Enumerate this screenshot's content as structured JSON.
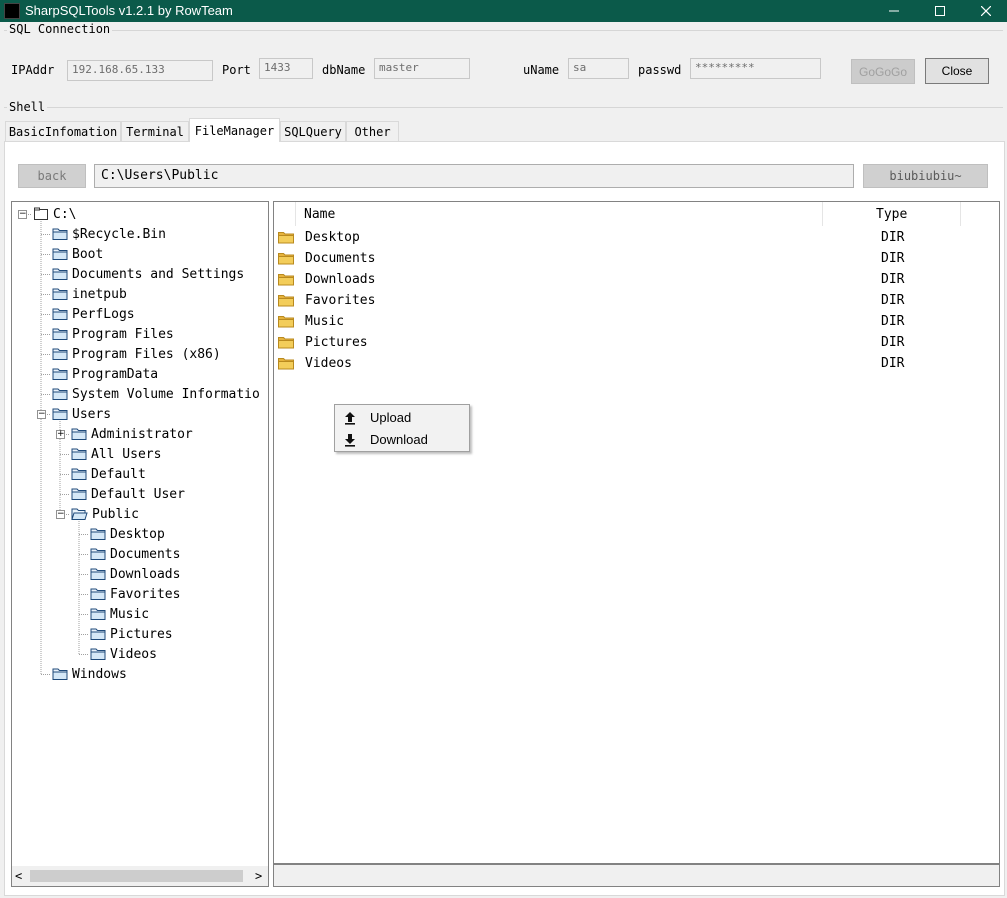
{
  "window": {
    "title": "SharpSQLTools v1.2.1 by RowTeam",
    "controls": {
      "minimize": "—",
      "maximize": "☐",
      "close": "✕"
    }
  },
  "connection": {
    "group_label": "SQL Connection",
    "ip_label": "IPAddr",
    "ip_value": "192.168.65.133",
    "port_label": "Port",
    "port_value": "1433",
    "db_label": "dbName",
    "db_value": "master",
    "user_label": "uName",
    "user_value": "sa",
    "pass_label": "passwd",
    "pass_value": "*********",
    "go_button": "GoGoGo",
    "close_button": "Close"
  },
  "shell": {
    "group_label": "Shell",
    "tabs": [
      {
        "label": "BasicInfomation",
        "active": false
      },
      {
        "label": "Terminal",
        "active": false
      },
      {
        "label": "FileManager",
        "active": true
      },
      {
        "label": "SQLQuery",
        "active": false
      },
      {
        "label": "Other",
        "active": false
      }
    ]
  },
  "file_manager": {
    "back_button": "back",
    "path": "C:\\Users\\Public",
    "action_button": "biubiubiu~",
    "tree": [
      {
        "label": "C:\\",
        "level": 0,
        "expander": "minus",
        "icon": "drive-icon"
      },
      {
        "label": "$Recycle.Bin",
        "level": 1
      },
      {
        "label": "Boot",
        "level": 1
      },
      {
        "label": "Documents and Settings",
        "level": 1
      },
      {
        "label": "inetpub",
        "level": 1
      },
      {
        "label": "PerfLogs",
        "level": 1
      },
      {
        "label": "Program Files",
        "level": 1
      },
      {
        "label": "Program Files (x86)",
        "level": 1
      },
      {
        "label": "ProgramData",
        "level": 1
      },
      {
        "label": "System Volume Informatio",
        "level": 1
      },
      {
        "label": "Users",
        "level": 1,
        "expander": "minus"
      },
      {
        "label": "Administrator",
        "level": 2,
        "expander": "plus"
      },
      {
        "label": "All Users",
        "level": 2
      },
      {
        "label": "Default",
        "level": 2
      },
      {
        "label": "Default User",
        "level": 2
      },
      {
        "label": "Public",
        "level": 2,
        "expander": "minus",
        "open": true
      },
      {
        "label": "Desktop",
        "level": 3
      },
      {
        "label": "Documents",
        "level": 3
      },
      {
        "label": "Downloads",
        "level": 3
      },
      {
        "label": "Favorites",
        "level": 3
      },
      {
        "label": "Music",
        "level": 3
      },
      {
        "label": "Pictures",
        "level": 3
      },
      {
        "label": "Videos",
        "level": 3
      },
      {
        "label": "Windows",
        "level": 1
      }
    ],
    "list_columns": {
      "name": "Name",
      "type": "Type"
    },
    "list_rows": [
      {
        "name": "Desktop",
        "type": "DIR"
      },
      {
        "name": "Documents",
        "type": "DIR"
      },
      {
        "name": "Downloads",
        "type": "DIR"
      },
      {
        "name": "Favorites",
        "type": "DIR"
      },
      {
        "name": "Music",
        "type": "DIR"
      },
      {
        "name": "Pictures",
        "type": "DIR"
      },
      {
        "name": "Videos",
        "type": "DIR"
      }
    ],
    "scroll_left": "<",
    "scroll_right": ">",
    "context_menu": [
      {
        "label": "Upload",
        "icon": "upload-icon"
      },
      {
        "label": "Download",
        "icon": "download-icon"
      }
    ]
  },
  "colors": {
    "titlebar": "#0b5a4a",
    "folder_yellow": "#f3cd5a",
    "folder_outline": "#1f4a7a"
  }
}
